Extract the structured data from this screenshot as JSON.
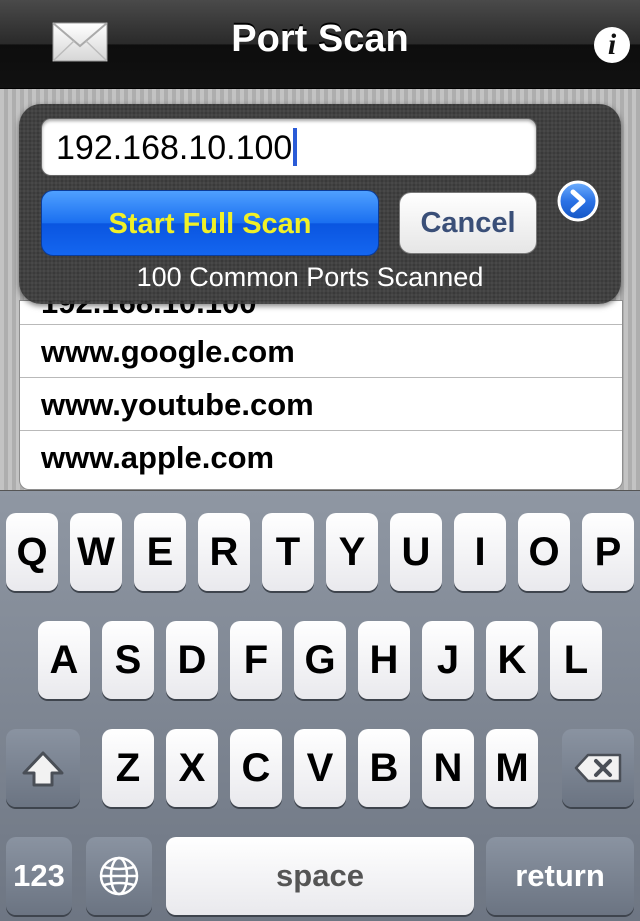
{
  "nav": {
    "title": "Port Scan"
  },
  "panel": {
    "ip_value": "192.168.10.100",
    "start_label": "Start Full Scan",
    "cancel_label": "Cancel",
    "status": "100 Common Ports Scanned"
  },
  "host_list": {
    "partial_row": "192.168.10.100",
    "rows": [
      "www.google.com",
      "www.youtube.com",
      "www.apple.com"
    ]
  },
  "keyboard": {
    "row1": [
      "Q",
      "W",
      "E",
      "R",
      "T",
      "Y",
      "U",
      "I",
      "O",
      "P"
    ],
    "row2": [
      "A",
      "S",
      "D",
      "F",
      "G",
      "H",
      "J",
      "K",
      "L"
    ],
    "row3": [
      "Z",
      "X",
      "C",
      "V",
      "B",
      "N",
      "M"
    ],
    "num_label": "123",
    "space_label": "space",
    "return_label": "return"
  },
  "icons": {
    "mail": "mail-icon",
    "info": "info-icon",
    "disclosure": "chevron-right-icon",
    "shift": "shift-icon",
    "backspace": "backspace-icon",
    "globe": "globe-icon"
  },
  "colors": {
    "start_button": "#1a6ff0",
    "start_text": "#f0f028",
    "caret": "#2a5bd7"
  }
}
